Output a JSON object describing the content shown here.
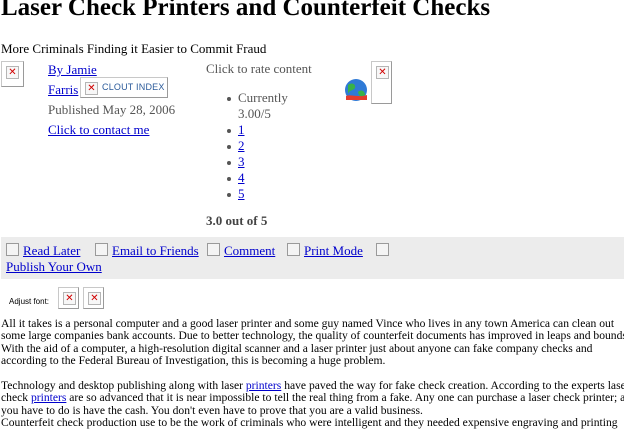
{
  "article": {
    "title": "Laser Check Printers and Counterfeit Checks",
    "subtitle": "More Criminals Finding it Easier to Commit Fraud",
    "author_link": "By Jamie",
    "author_link_2": "Farris",
    "published": "Published May 28, 2006",
    "contact_link": "Click to contact me",
    "clout_badge": "CLOUT INDEX",
    "body": {
      "p1": "All it takes is a personal computer and a good laser printer and some guy named Vince who lives in any town America can clean out some large companies bank accounts. Due to better technology, the quality of counterfeit documents has improved in leaps and bounds. With the aid of a computer, a high-resolution digital scanner and a laser printer just about anyone can fake company checks and according to the Federal Bureau of Investigation, this is becoming a huge problem.",
      "p2_a": "Technology and desktop publishing along with laser ",
      "p2_link1": "printers",
      "p2_b": " have paved the way for fake check creation. According to the experts laser check ",
      "p2_link2": "printers",
      "p2_c": " are so advanced that it is near impossible to tell the real thing from a fake. Any one can purchase a laser check printer; all you have to do is have the cash. You don't even have to prove that you are a valid business.",
      "p3": "Counterfeit check production use to be the work of criminals who were intelligent and they needed expensive engraving and printing"
    }
  },
  "rating": {
    "prompt": "Click to rate content",
    "current_label": "Currently",
    "current_value": "3.00/5",
    "options": [
      "1",
      "2",
      "3",
      "4",
      "5"
    ],
    "summary": "3.0 out of 5"
  },
  "actions": {
    "read_later": "Read Later",
    "email": "Email to Friends",
    "comment": "Comment",
    "print": "Print Mode",
    "publish": "Publish Your Own"
  },
  "font_controls": {
    "label": "Adjust font:"
  },
  "icons": {
    "broken_image": "broken-image-icon",
    "globe": "globe-icon",
    "checkbox": "checkbox-icon"
  },
  "colors": {
    "link": "#0000cc",
    "action_bar_bg": "#ececec",
    "broken_x": "#d00000"
  }
}
